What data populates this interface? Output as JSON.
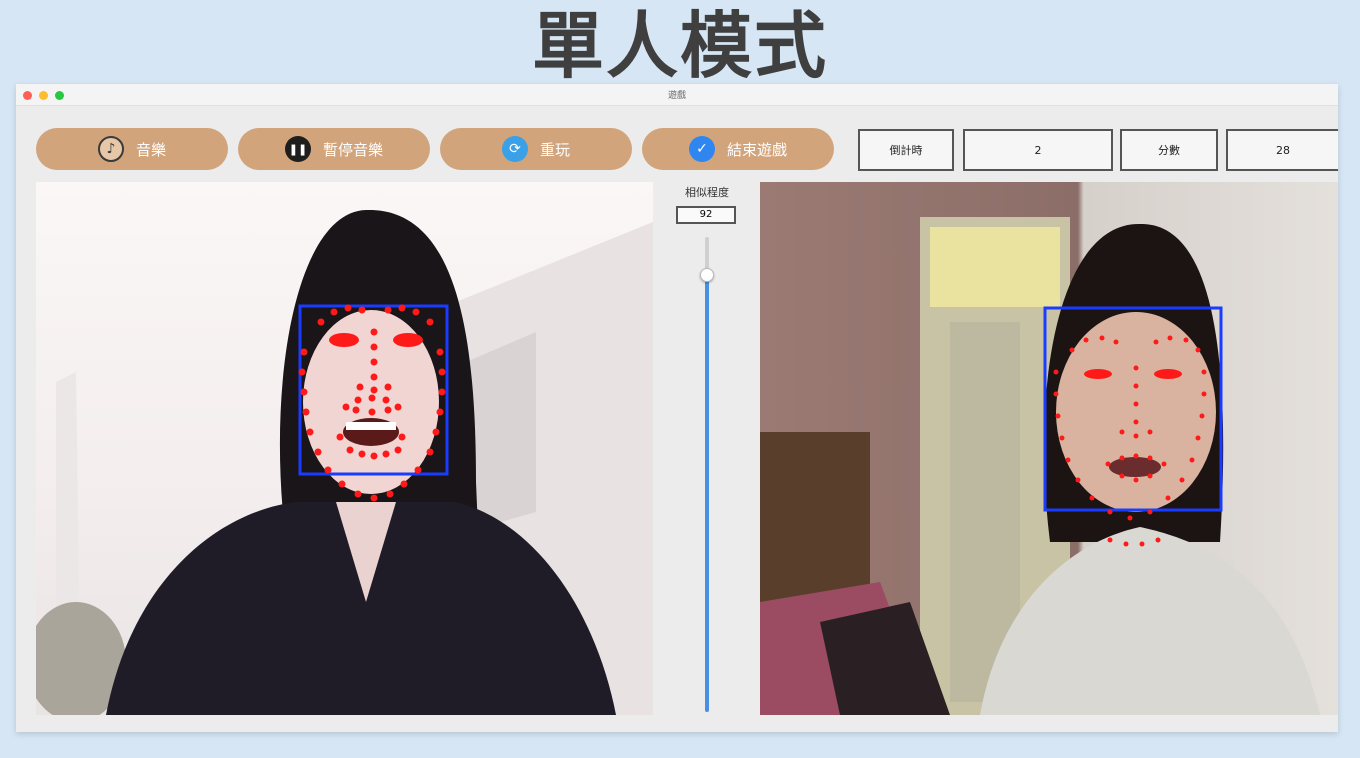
{
  "slide": {
    "title": "單人模式"
  },
  "window": {
    "title": "遊戲"
  },
  "toolbar": {
    "music_label": "音樂",
    "pause_music_label": "暫停音樂",
    "replay_label": "重玩",
    "end_game_label": "結束遊戲",
    "countdown_label": "倒計時",
    "countdown_value": "2",
    "score_label": "分數",
    "score_value": "28"
  },
  "similarity": {
    "label": "相似程度",
    "value": "92",
    "level_percent": 92
  },
  "colors": {
    "button_bg": "#d2a47c",
    "face_box": "#1a3cff",
    "landmark": "#ff1a1a",
    "slider_fill": "#4a90e2"
  }
}
